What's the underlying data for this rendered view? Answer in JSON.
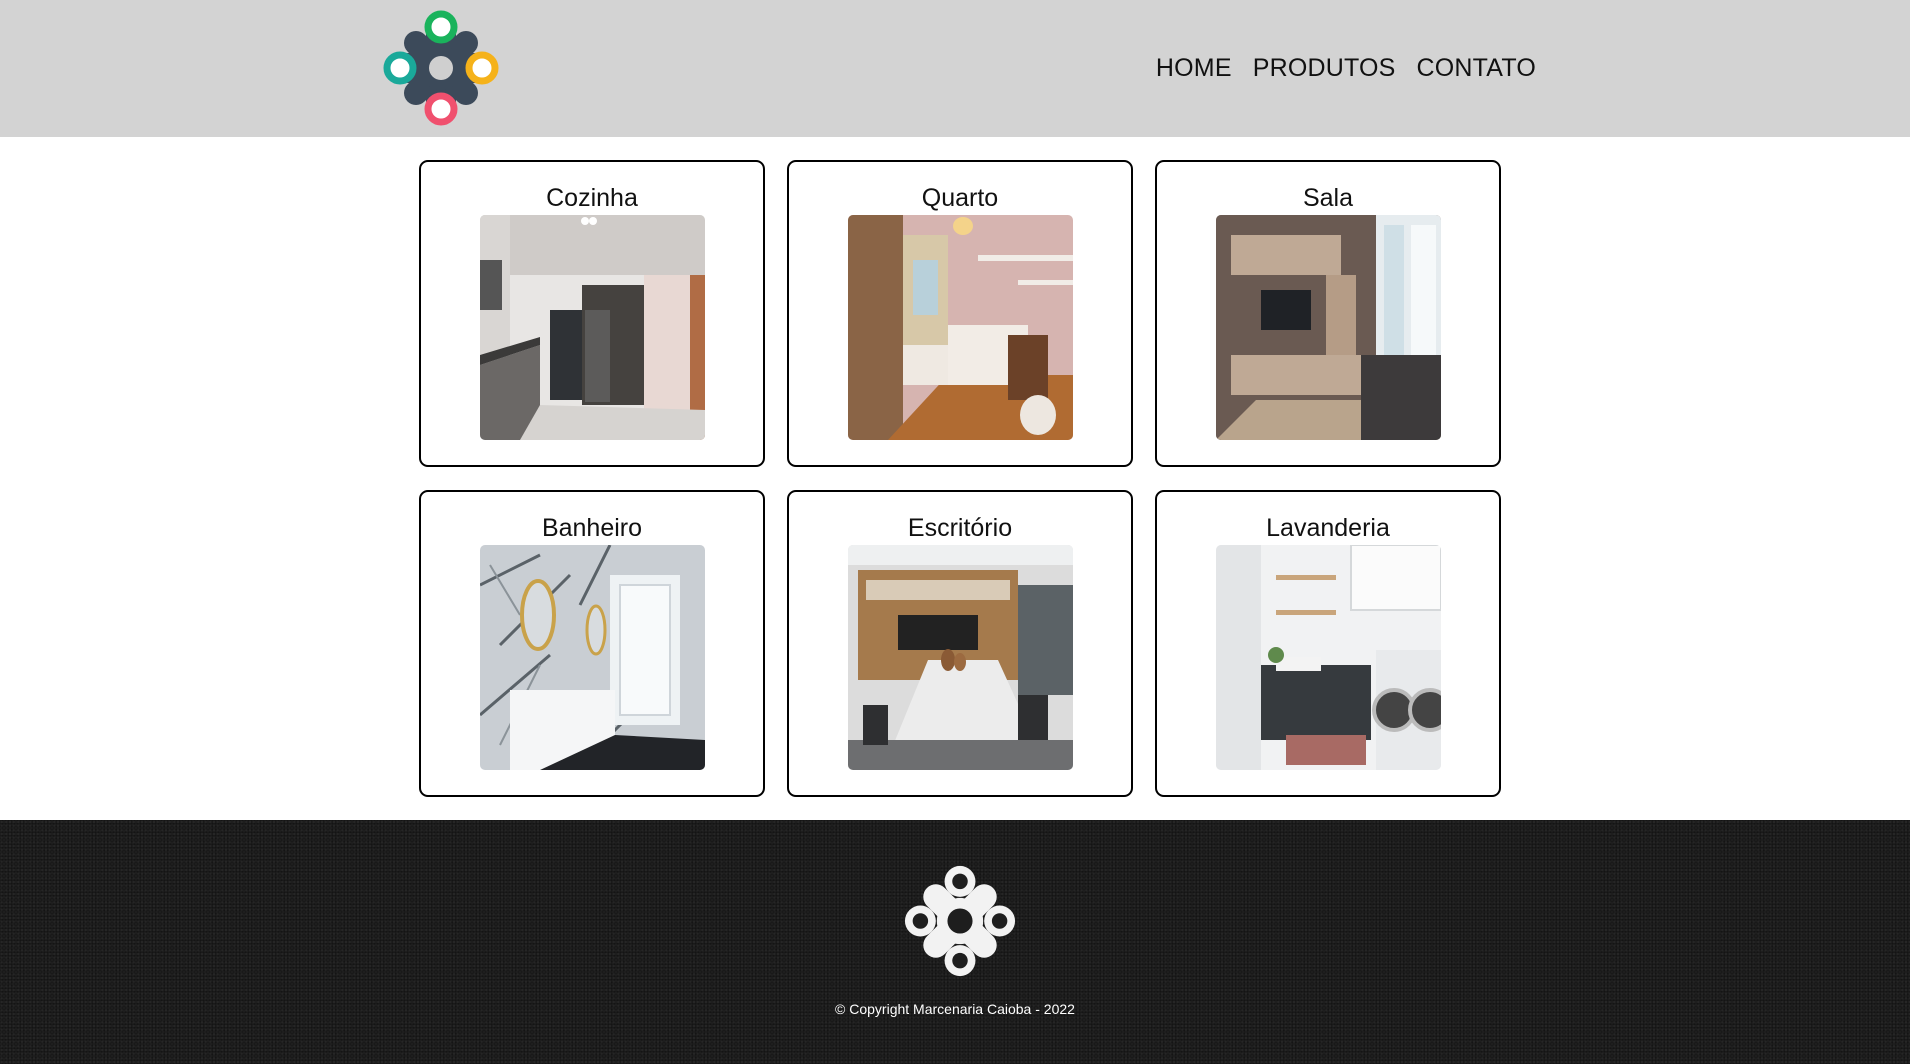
{
  "nav": {
    "items": [
      {
        "label": "HOME"
      },
      {
        "label": "PRODUTOS"
      },
      {
        "label": "CONTATO"
      }
    ]
  },
  "categories": [
    {
      "title": "Cozinha",
      "image": "kitchen-photo"
    },
    {
      "title": "Quarto",
      "image": "bedroom-photo"
    },
    {
      "title": "Sala",
      "image": "living-room-photo"
    },
    {
      "title": "Banheiro",
      "image": "bathroom-photo"
    },
    {
      "title": "Escritório",
      "image": "office-photo"
    },
    {
      "title": "Lavanderia",
      "image": "laundry-photo"
    }
  ],
  "footer": {
    "copyright": "© Copyright Marcenaria Caioba - 2022"
  },
  "colors": {
    "header_bg": "#d3d3d3",
    "footer_bg": "#1e1e1e",
    "logo_body": "#3c4a5a",
    "logo_green": "#1ab35c",
    "logo_teal": "#1aa99a",
    "logo_orange": "#f5b21a",
    "logo_pink": "#f0506e"
  }
}
